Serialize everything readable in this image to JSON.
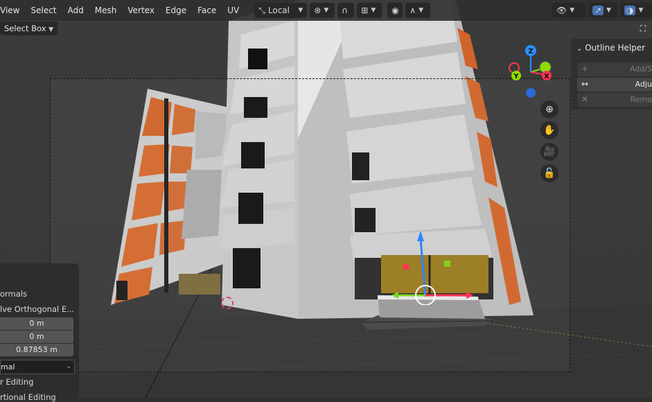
{
  "menu": {
    "items": [
      "View",
      "Select",
      "Add",
      "Mesh",
      "Vertex",
      "Edge",
      "Face",
      "UV"
    ]
  },
  "header": {
    "transform_orientation": "Local"
  },
  "toolbar": {
    "select_mode_label": "Select Box"
  },
  "outline_helper": {
    "title": "Outline Helper",
    "buttons": [
      {
        "label": "Add/S",
        "icon": "plus-icon"
      },
      {
        "label": "Adju",
        "icon": "arrows-horizontal-icon"
      },
      {
        "label": "Remo",
        "icon": "x-icon"
      }
    ]
  },
  "operator_panel": {
    "row1": "ormals",
    "row2": "lve Orthogonal E...",
    "fields": [
      "0 m",
      "0 m",
      "0.87853 m"
    ],
    "select_value": "mal",
    "row3": "r Editing",
    "row4": "rtional Editing"
  },
  "gizmo": {
    "z_label": "Z",
    "y_label": "Y",
    "x_label": "X"
  },
  "colors": {
    "accent": "#4772b3",
    "axis_x": "#ff3352",
    "axis_y": "#8bdc00",
    "axis_z": "#2890ff"
  }
}
